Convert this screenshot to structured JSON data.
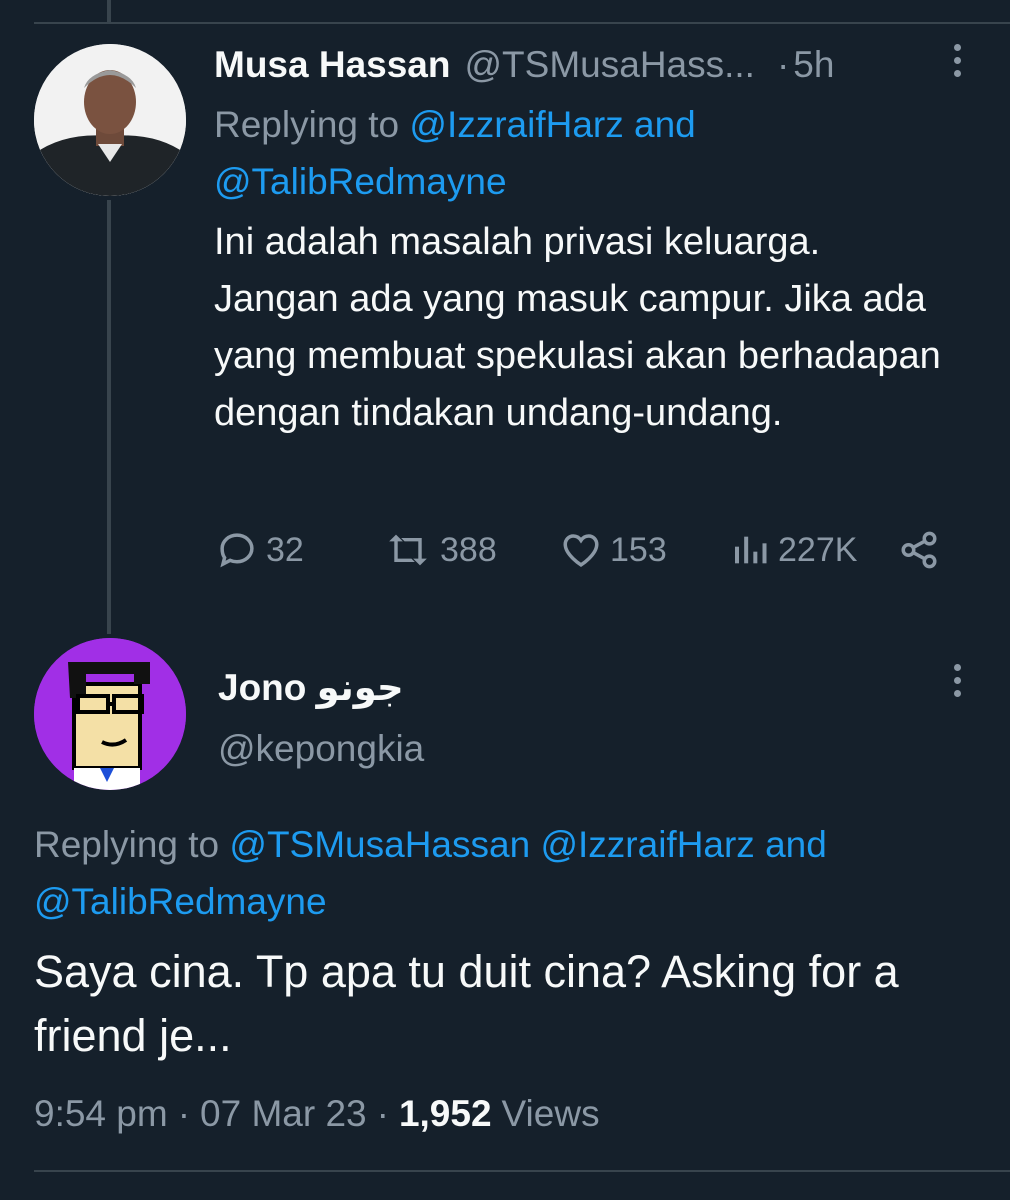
{
  "tweet1": {
    "name": "Musa Hassan",
    "handle": "@TSMusaHass...",
    "separator": "·",
    "time": "5h",
    "replying_prefix": "Replying to",
    "replying_links": [
      "@IzzraifHarz",
      "and",
      "@TalibRedmayne"
    ],
    "body": "Ini adalah masalah privasi keluarga. Jangan ada yang masuk campur. Jika ada yang membuat spekulasi akan berhadapan dengan tindakan undang-undang.",
    "replies": "32",
    "retweets": "388",
    "likes": "153",
    "views": "227K"
  },
  "tweet2": {
    "name": "Jono جونو",
    "handle": "@kepongkia",
    "replying_prefix": "Replying to",
    "replying_links": [
      "@TSMusaHassan",
      "@IzzraifHarz",
      "and",
      "@TalibRedmayne"
    ],
    "body": "Saya cina. Tp apa tu duit cina? Asking for a friend je...",
    "time": "9:54 pm",
    "sep1": "·",
    "date": "07 Mar 23",
    "sep2": "·",
    "view_count": "1,952",
    "views_label": "Views"
  },
  "icons": {
    "reply": "reply-icon",
    "retweet": "retweet-icon",
    "like": "heart-icon",
    "views": "analytics-icon",
    "share": "share-icon",
    "more": "more-icon"
  },
  "colors": {
    "background": "#15202b",
    "text": "#f7f9f9",
    "muted": "#8b98a5",
    "link": "#1d9bf0",
    "divider": "#38444d",
    "avatar2_bg": "#a12fe6"
  }
}
